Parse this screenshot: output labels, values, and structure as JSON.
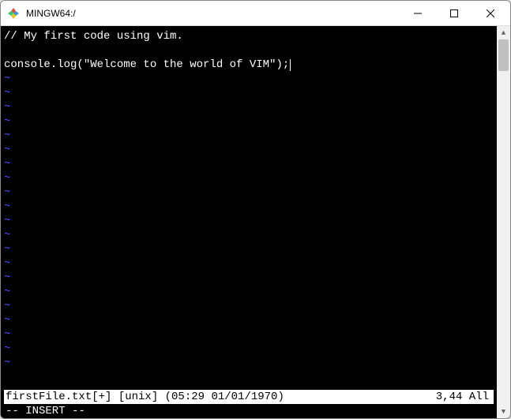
{
  "window": {
    "title": "MINGW64:/"
  },
  "editor": {
    "lines": [
      "// My first code using vim.",
      "",
      "console.log(\"Welcome to the world of VIM\");"
    ],
    "tilde": "~",
    "tilde_count": 21
  },
  "status": {
    "left": "firstFile.txt[+] [unix] (05:29 01/01/1970)",
    "right": "3,44 All"
  },
  "mode": "-- INSERT --",
  "icons": {
    "app": "mingw-logo",
    "minimize": "minimize-icon",
    "maximize": "maximize-icon",
    "close": "close-icon",
    "scroll_up": "▲",
    "scroll_down": "▼"
  }
}
